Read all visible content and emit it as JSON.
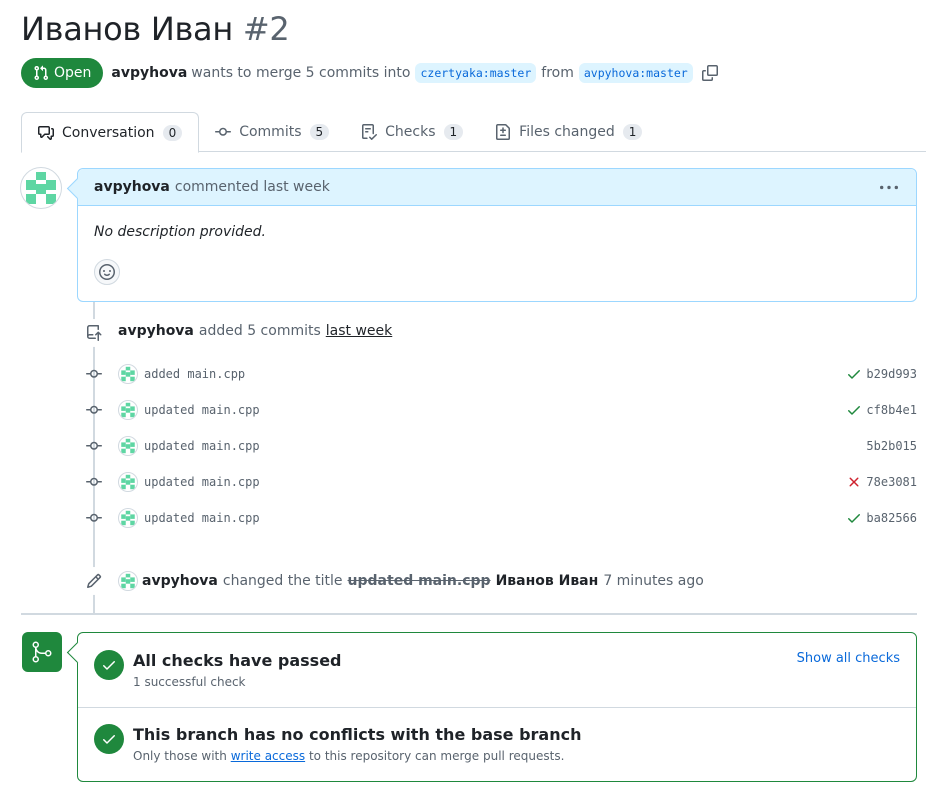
{
  "pr": {
    "title": "Иванов Иван",
    "number": "#2",
    "state": "Open",
    "author": "avpyhova",
    "merge_text": "wants to merge 5 commits into",
    "base_branch": "czertyaka:master",
    "from_text": "from",
    "head_branch": "avpyhova:master"
  },
  "tabs": [
    {
      "label": "Conversation",
      "count": "0"
    },
    {
      "label": "Commits",
      "count": "5"
    },
    {
      "label": "Checks",
      "count": "1"
    },
    {
      "label": "Files changed",
      "count": "1"
    }
  ],
  "comment": {
    "author": "avpyhova",
    "action": "commented last week",
    "body": "No description provided."
  },
  "commits_event": {
    "author": "avpyhova",
    "action": "added 5 commits",
    "when": "last week"
  },
  "commits": [
    {
      "message": "added main.cpp",
      "sha": "b29d993",
      "status": "success"
    },
    {
      "message": "updated main.cpp",
      "sha": "cf8b4e1",
      "status": "success"
    },
    {
      "message": "updated main.cpp",
      "sha": "5b2b015",
      "status": "none"
    },
    {
      "message": "updated main.cpp",
      "sha": "78e3081",
      "status": "failure"
    },
    {
      "message": "updated main.cpp",
      "sha": "ba82566",
      "status": "success"
    }
  ],
  "rename_event": {
    "author": "avpyhova",
    "action": "changed the title",
    "old_title": "updated main.cpp",
    "new_title": "Иванов Иван",
    "when": "7 minutes ago"
  },
  "merge": {
    "checks_title": "All checks have passed",
    "checks_sub": "1 successful check",
    "show_all": "Show all checks",
    "conflicts_title": "This branch has no conflicts with the base branch",
    "conflicts_sub_pre": "Only those with",
    "conflicts_sub_link": "write access",
    "conflicts_sub_post": "to this repository can merge pull requests."
  },
  "colors": {
    "success": "#1f883d",
    "failure": "#cf222e",
    "link": "#0969da",
    "avatar": "#5ed6a3"
  }
}
